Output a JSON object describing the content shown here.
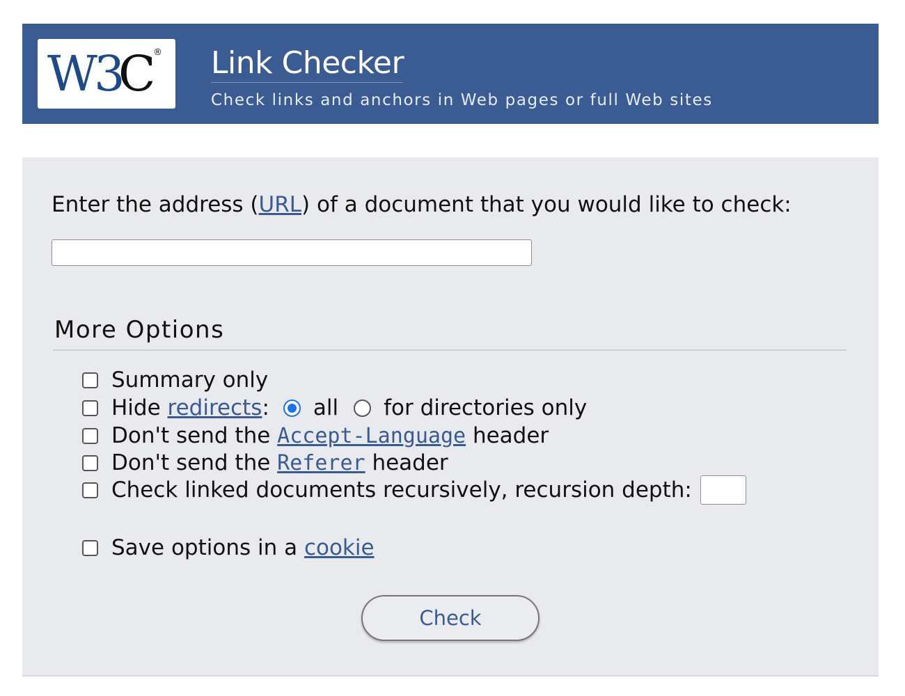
{
  "header": {
    "logo_text": "W3C",
    "title": "Link Checker",
    "subtitle": "Check links and anchors in Web pages or full Web sites"
  },
  "form": {
    "prompt_before": "Enter the address (",
    "prompt_link": "URL",
    "prompt_after": ") of a document that you would like to check:",
    "url_value": "",
    "more_options_title": "More Options",
    "options": {
      "summary_only": "Summary only",
      "hide_prefix": "Hide ",
      "hide_link": "redirects",
      "hide_colon": ":",
      "radio_all": "all",
      "radio_dirs": "for directories only",
      "accept_prefix": "Don't send the ",
      "accept_link": "Accept-Language",
      "accept_suffix": " header",
      "referer_prefix": "Don't send the ",
      "referer_link": "Referer",
      "referer_suffix": " header",
      "recursive_label": "Check linked documents recursively, recursion depth:",
      "depth_value": "",
      "cookie_prefix": "Save options in a ",
      "cookie_link": "cookie"
    },
    "selected_redirect_scope": "all",
    "submit_label": "Check"
  },
  "colors": {
    "banner": "#3b5c92",
    "panel": "#e9eaed",
    "link": "#3a5a94",
    "radio_accent": "#1a73e8"
  },
  "icons": [
    "w3c-logo-icon"
  ]
}
